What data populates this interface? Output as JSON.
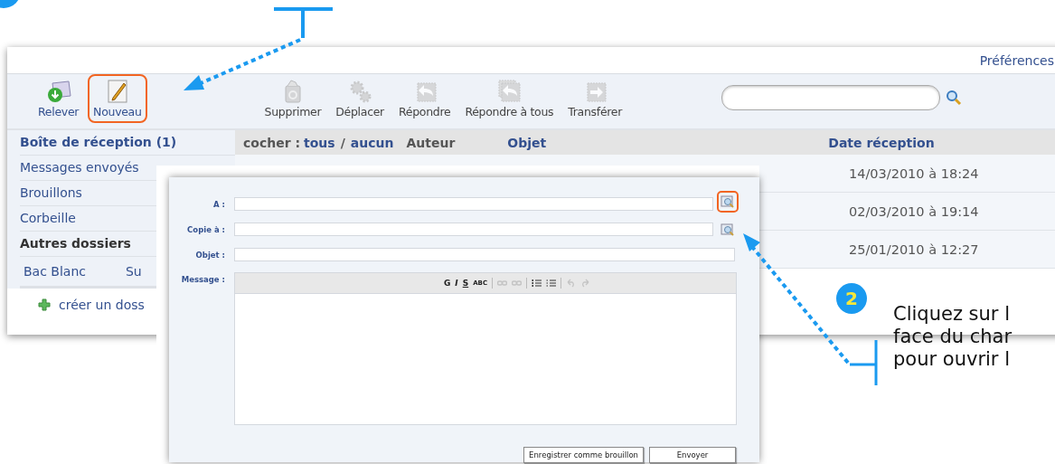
{
  "topbar": {
    "link": "Préférences"
  },
  "toolbar": {
    "buttons": [
      {
        "kind": "fetch",
        "label": "Relever",
        "disabled": false,
        "highlighted": false
      },
      {
        "kind": "new",
        "label": "Nouveau",
        "disabled": false,
        "highlighted": true
      },
      {
        "kind": "delete",
        "label": "Supprimer",
        "disabled": true,
        "highlighted": false
      },
      {
        "kind": "move",
        "label": "Déplacer",
        "disabled": true,
        "highlighted": false
      },
      {
        "kind": "reply",
        "label": "Répondre",
        "disabled": true,
        "highlighted": false
      },
      {
        "kind": "reply_all",
        "label": "Répondre à tous",
        "disabled": true,
        "highlighted": false
      },
      {
        "kind": "forward",
        "label": "Transférer",
        "disabled": true,
        "highlighted": false
      }
    ]
  },
  "sidebar": {
    "items": [
      {
        "kind": "current",
        "label": "Boîte de réception (1)"
      },
      {
        "kind": "folder",
        "label": "Messages envoyés"
      },
      {
        "kind": "folder",
        "label": "Brouillons"
      },
      {
        "kind": "folder",
        "label": "Corbeille"
      },
      {
        "kind": "section",
        "label": "Autres dossiers"
      }
    ],
    "custom_folders": [
      "Bac Blanc",
      "Su"
    ],
    "create_link": "créer un doss"
  },
  "message_list": {
    "check_label": "cocher :",
    "check_all": "tous",
    "separator": "/",
    "check_none": "aucun",
    "columns": [
      "Auteur",
      "Objet",
      "Date réception"
    ],
    "rows": [
      {
        "date": "14/03/2010 à 18:24"
      },
      {
        "date": "02/03/2010 à 19:14"
      },
      {
        "date": "25/01/2010 à 12:27"
      }
    ]
  },
  "compose": {
    "fields": [
      {
        "label": "A :",
        "address_book": true,
        "highlighted": true
      },
      {
        "label": "Copie à :",
        "address_book": true,
        "highlighted": false
      },
      {
        "label": "Objet :",
        "address_book": false
      }
    ],
    "message_label": "Message :",
    "editor_tools": [
      {
        "kind": "bold",
        "label": "G",
        "disabled": false
      },
      {
        "kind": "italic",
        "label": "I",
        "disabled": false
      },
      {
        "kind": "underline",
        "label": "S",
        "disabled": false
      },
      {
        "kind": "spellcheck",
        "label": "ABC",
        "disabled": false
      },
      {
        "kind": "separator"
      },
      {
        "kind": "link",
        "disabled": true
      },
      {
        "kind": "unlink",
        "disabled": true
      },
      {
        "kind": "separator"
      },
      {
        "kind": "bullets",
        "disabled": false
      },
      {
        "kind": "numbers",
        "disabled": false
      },
      {
        "kind": "separator"
      },
      {
        "kind": "undo",
        "disabled": true
      },
      {
        "kind": "redo",
        "disabled": true
      }
    ],
    "buttons": [
      "Enregistrer comme brouillon",
      "Envoyer"
    ]
  },
  "callout": {
    "number": "2",
    "lines": [
      "Cliquez sur l",
      "face du char",
      "pour ouvrir l"
    ]
  }
}
